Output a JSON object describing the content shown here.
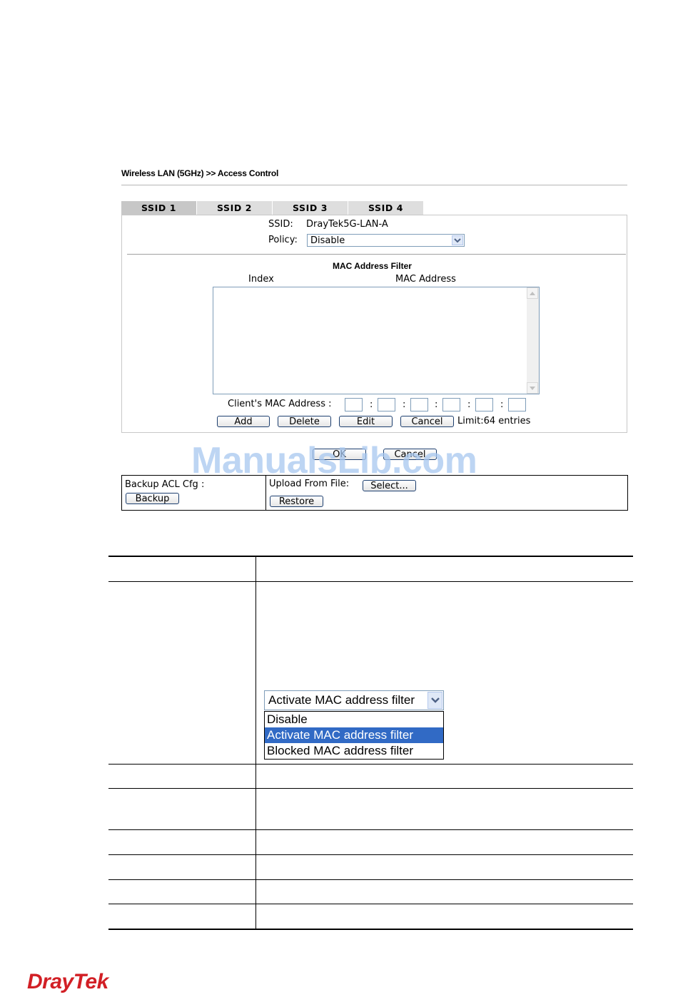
{
  "breadcrumb": "Wireless LAN (5GHz) >> Access Control",
  "tabs": [
    "SSID 1",
    "SSID 2",
    "SSID 3",
    "SSID 4"
  ],
  "ssid": {
    "label": "SSID:",
    "value": "DrayTek5G-LAN-A"
  },
  "policy": {
    "label": "Policy:",
    "value": "Disable"
  },
  "mac_filter": {
    "title": "MAC Address Filter",
    "col_index": "Index",
    "col_mac": "MAC Address",
    "client_label": "Client's MAC Address :",
    "separator": ":",
    "buttons": [
      "Add",
      "Delete",
      "Edit",
      "Cancel"
    ],
    "limit": "Limit:64 entries"
  },
  "form_buttons": {
    "ok": "OK",
    "cancel": "Cancel"
  },
  "watermark": "ManualsLib.com",
  "backup": {
    "label": "Backup ACL Cfg :",
    "backup_button": "Backup",
    "upload_label": "Upload From File:",
    "select_button": "Select...",
    "restore_button": "Restore"
  },
  "policy_dropdown_screenshot": {
    "selected": "Activate MAC address filter",
    "options": [
      "Disable",
      "Activate MAC address filter",
      "Blocked MAC address filter"
    ],
    "highlighted_index": 1
  },
  "logo": {
    "brand": "DrayTek",
    "color": "#d21f25"
  },
  "colors": {
    "highlight": "#316ac5",
    "tab_active": "#c7c7c7",
    "tab": "#dedede",
    "watermark": "#a8c8f0"
  }
}
